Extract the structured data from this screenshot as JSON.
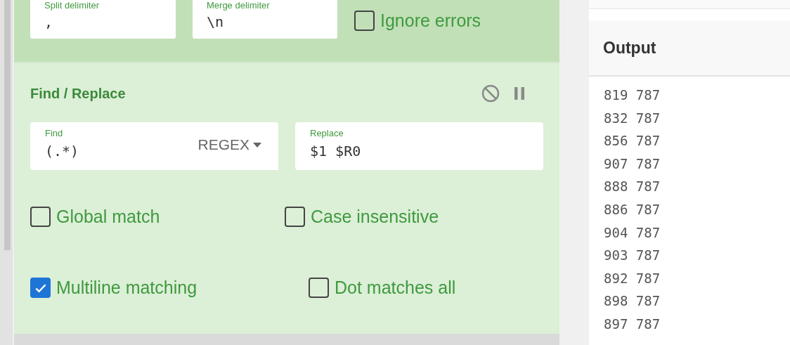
{
  "split_merge": {
    "split_delimiter": {
      "label": "Split delimiter",
      "value": ","
    },
    "merge_delimiter": {
      "label": "Merge delimiter",
      "value": "\\n"
    },
    "ignore_errors": {
      "label": "Ignore errors",
      "checked": false
    }
  },
  "find_replace": {
    "title": "Find / Replace",
    "find": {
      "label": "Find",
      "value": "(.*)",
      "mode": "REGEX"
    },
    "replace": {
      "label": "Replace",
      "value": "$1 $R0"
    },
    "options": [
      {
        "label": "Global match",
        "checked": false
      },
      {
        "label": "Case insensitive",
        "checked": false
      },
      {
        "label": "Multiline matching",
        "checked": true
      },
      {
        "label": "Dot matches all",
        "checked": false
      }
    ]
  },
  "output": {
    "title": "Output",
    "lines": [
      "819 787",
      "832 787",
      "856 787",
      "907 787",
      "888 787",
      "886 787",
      "904 787",
      "903 787",
      "892 787",
      "898 787",
      "897 787"
    ]
  }
}
